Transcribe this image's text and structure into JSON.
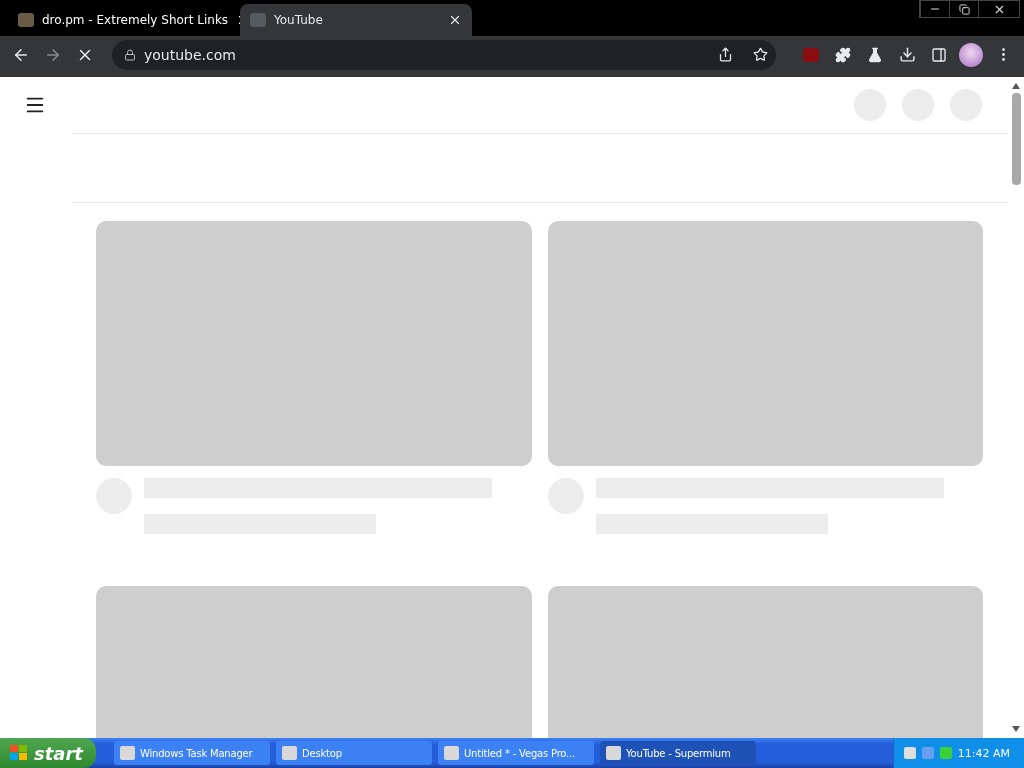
{
  "browser_tabs": [
    {
      "title": "dro.pm - Extremely Short Links",
      "selected": false
    },
    {
      "title": "YouTube",
      "selected": true
    }
  ],
  "address_bar": {
    "url": "youtube.com"
  },
  "feed": {
    "cards": [
      {
        "kind": "placeholder"
      },
      {
        "kind": "placeholder"
      },
      {
        "kind": "thumbnail"
      },
      {
        "kind": "thumbnail"
      }
    ]
  },
  "taskbar": {
    "start": "start",
    "items": [
      {
        "label": "Windows Task Manager",
        "selected": false
      },
      {
        "label": "Desktop",
        "selected": false
      },
      {
        "label": "Untitled * - Vegas Pro...",
        "selected": false
      },
      {
        "label": "YouTube - Supermium",
        "selected": true
      }
    ],
    "clock": "11:42 AM"
  }
}
